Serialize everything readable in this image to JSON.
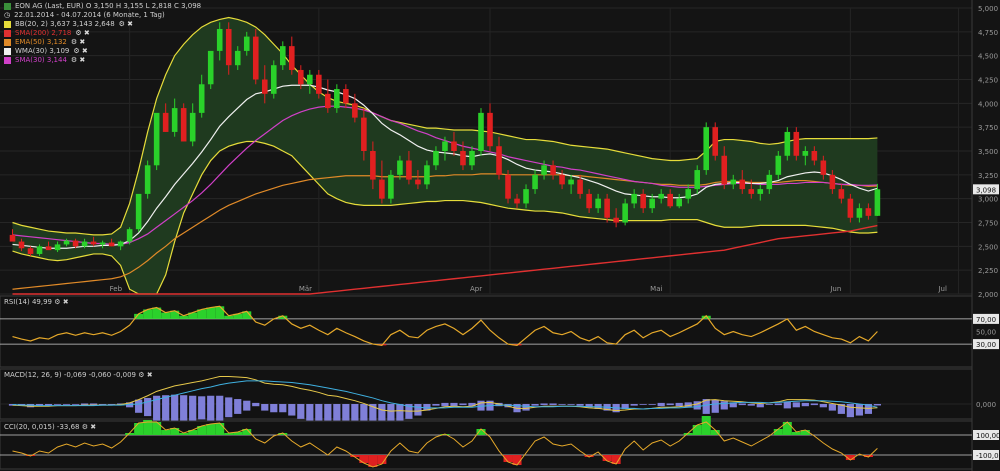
{
  "header": {
    "title": "EON AG (Last, EUR) O 3,150 H 3,155 L 2,818 C 3,098",
    "date_range": "22.01.2014 - 04.07.2014 (6 Monate, 1 Tag)"
  },
  "indicators": [
    {
      "label": "BB(20, 2) 3,637 3,143 2,648",
      "color": "#e6dc3a"
    },
    {
      "label": "SMA(200) 2,718",
      "color": "#e03030"
    },
    {
      "label": "EMA(50) 3,132",
      "color": "#e08a28"
    },
    {
      "label": "WMA(30) 3,109",
      "color": "#f0f0f0"
    },
    {
      "label": "SMA(30) 3,144",
      "color": "#d040c8"
    }
  ],
  "ctl_symbols": "⚙ ✖",
  "price_axis": {
    "ticks": [
      "5,000",
      "4,750",
      "4,500",
      "4,250",
      "4,000",
      "3,750",
      "3,500",
      "3,250",
      "3,000",
      "2,750",
      "2,500",
      "2,250",
      "2,000"
    ],
    "last_price": "3,098"
  },
  "months": [
    "Feb",
    "Mär",
    "Apr",
    "Mai",
    "Jun",
    "Jul"
  ],
  "panels": {
    "rsi": {
      "label": "RSI(14) 49,99",
      "levels": [
        "70,00",
        "50,00",
        "30,00"
      ]
    },
    "macd": {
      "label": "MACD(12, 26, 9) -0,069 -0,060 -0,009",
      "levels": [
        "0,000"
      ]
    },
    "cci": {
      "label": "CCI(20, 0,015) -33,68",
      "levels": [
        "100,00",
        "-100,00"
      ]
    }
  },
  "chart_data": {
    "type": "candlestick",
    "ylim": [
      2.0,
      5.0
    ],
    "candles": [
      [
        2.62,
        2.68,
        2.58,
        2.55
      ],
      [
        2.55,
        2.58,
        2.45,
        2.48
      ],
      [
        2.48,
        2.5,
        2.4,
        2.42
      ],
      [
        2.42,
        2.52,
        2.4,
        2.5
      ],
      [
        2.5,
        2.55,
        2.48,
        2.46
      ],
      [
        2.46,
        2.55,
        2.44,
        2.52
      ],
      [
        2.52,
        2.58,
        2.5,
        2.56
      ],
      [
        2.56,
        2.58,
        2.48,
        2.5
      ],
      [
        2.5,
        2.58,
        2.48,
        2.55
      ],
      [
        2.55,
        2.6,
        2.5,
        2.52
      ],
      [
        2.52,
        2.56,
        2.48,
        2.54
      ],
      [
        2.54,
        2.58,
        2.5,
        2.5
      ],
      [
        2.5,
        2.56,
        2.46,
        2.55
      ],
      [
        2.55,
        2.7,
        2.52,
        2.68
      ],
      [
        2.68,
        3.0,
        2.65,
        3.05
      ],
      [
        3.05,
        3.4,
        3.0,
        3.35
      ],
      [
        3.35,
        3.8,
        3.3,
        3.9
      ],
      [
        3.9,
        4.0,
        3.7,
        3.7
      ],
      [
        3.7,
        4.05,
        3.65,
        3.95
      ],
      [
        3.95,
        4.0,
        3.6,
        3.6
      ],
      [
        3.6,
        4.0,
        3.55,
        3.9
      ],
      [
        3.9,
        4.3,
        3.85,
        4.2
      ],
      [
        4.2,
        4.5,
        4.15,
        4.55
      ],
      [
        4.55,
        4.85,
        4.45,
        4.78
      ],
      [
        4.78,
        4.85,
        4.3,
        4.4
      ],
      [
        4.4,
        4.6,
        4.35,
        4.55
      ],
      [
        4.55,
        4.75,
        4.5,
        4.7
      ],
      [
        4.7,
        4.78,
        4.2,
        4.25
      ],
      [
        4.25,
        4.4,
        4.0,
        4.1
      ],
      [
        4.1,
        4.45,
        4.05,
        4.4
      ],
      [
        4.4,
        4.65,
        4.35,
        4.6
      ],
      [
        4.6,
        4.7,
        4.3,
        4.35
      ],
      [
        4.35,
        4.4,
        4.15,
        4.2
      ],
      [
        4.2,
        4.35,
        4.1,
        4.3
      ],
      [
        4.3,
        4.35,
        4.05,
        4.1
      ],
      [
        4.1,
        4.25,
        3.9,
        3.95
      ],
      [
        3.95,
        4.2,
        3.9,
        4.15
      ],
      [
        4.15,
        4.2,
        3.95,
        4.0
      ],
      [
        4.0,
        4.1,
        3.8,
        3.85
      ],
      [
        3.85,
        3.95,
        3.4,
        3.5
      ],
      [
        3.5,
        3.6,
        3.1,
        3.2
      ],
      [
        3.2,
        3.4,
        2.95,
        3.0
      ],
      [
        3.0,
        3.3,
        2.95,
        3.25
      ],
      [
        3.25,
        3.45,
        3.2,
        3.4
      ],
      [
        3.4,
        3.5,
        3.15,
        3.2
      ],
      [
        3.2,
        3.3,
        3.1,
        3.15
      ],
      [
        3.15,
        3.4,
        3.1,
        3.35
      ],
      [
        3.35,
        3.55,
        3.3,
        3.5
      ],
      [
        3.5,
        3.65,
        3.4,
        3.6
      ],
      [
        3.6,
        3.7,
        3.45,
        3.5
      ],
      [
        3.5,
        3.6,
        3.3,
        3.35
      ],
      [
        3.35,
        3.55,
        3.3,
        3.5
      ],
      [
        3.5,
        3.95,
        3.45,
        3.9
      ],
      [
        3.9,
        4.0,
        3.5,
        3.55
      ],
      [
        3.55,
        3.65,
        3.2,
        3.25
      ],
      [
        3.25,
        3.3,
        2.95,
        3.0
      ],
      [
        3.0,
        3.05,
        2.9,
        2.95
      ],
      [
        2.95,
        3.15,
        2.9,
        3.1
      ],
      [
        3.1,
        3.3,
        3.05,
        3.25
      ],
      [
        3.25,
        3.4,
        3.2,
        3.35
      ],
      [
        3.35,
        3.4,
        3.2,
        3.25
      ],
      [
        3.25,
        3.3,
        3.1,
        3.15
      ],
      [
        3.15,
        3.25,
        3.05,
        3.2
      ],
      [
        3.2,
        3.25,
        3.0,
        3.05
      ],
      [
        3.05,
        3.1,
        2.85,
        2.9
      ],
      [
        2.9,
        3.05,
        2.85,
        3.0
      ],
      [
        3.0,
        3.05,
        2.75,
        2.8
      ],
      [
        2.8,
        2.9,
        2.7,
        2.75
      ],
      [
        2.75,
        3.0,
        2.72,
        2.95
      ],
      [
        2.95,
        3.1,
        2.9,
        3.05
      ],
      [
        3.05,
        3.1,
        2.85,
        2.9
      ],
      [
        2.9,
        3.05,
        2.85,
        3.0
      ],
      [
        3.0,
        3.1,
        2.95,
        3.05
      ],
      [
        3.05,
        3.1,
        2.9,
        2.92
      ],
      [
        2.92,
        3.05,
        2.9,
        3.0
      ],
      [
        3.0,
        3.15,
        2.95,
        3.1
      ],
      [
        3.1,
        3.35,
        3.05,
        3.3
      ],
      [
        3.3,
        3.8,
        3.25,
        3.75
      ],
      [
        3.75,
        3.8,
        3.4,
        3.45
      ],
      [
        3.45,
        3.55,
        3.1,
        3.15
      ],
      [
        3.15,
        3.25,
        3.1,
        3.2
      ],
      [
        3.2,
        3.3,
        3.05,
        3.1
      ],
      [
        3.1,
        3.2,
        3.0,
        3.05
      ],
      [
        3.05,
        3.15,
        2.98,
        3.1
      ],
      [
        3.1,
        3.3,
        3.05,
        3.25
      ],
      [
        3.25,
        3.5,
        3.2,
        3.45
      ],
      [
        3.45,
        3.75,
        3.4,
        3.7
      ],
      [
        3.7,
        3.75,
        3.4,
        3.45
      ],
      [
        3.45,
        3.55,
        3.35,
        3.5
      ],
      [
        3.5,
        3.55,
        3.35,
        3.4
      ],
      [
        3.4,
        3.45,
        3.2,
        3.25
      ],
      [
        3.25,
        3.3,
        3.05,
        3.1
      ],
      [
        3.1,
        3.15,
        2.95,
        3.0
      ],
      [
        3.0,
        3.05,
        2.75,
        2.8
      ],
      [
        2.8,
        2.95,
        2.75,
        2.9
      ],
      [
        2.9,
        2.95,
        2.78,
        2.82
      ],
      [
        2.82,
        3.155,
        2.818,
        3.098
      ]
    ],
    "bb_upper": [
      2.75,
      2.72,
      2.7,
      2.68,
      2.66,
      2.65,
      2.64,
      2.64,
      2.63,
      2.62,
      2.62,
      2.63,
      2.7,
      2.95,
      3.3,
      3.7,
      4.05,
      4.3,
      4.5,
      4.62,
      4.72,
      4.8,
      4.85,
      4.88,
      4.9,
      4.88,
      4.85,
      4.8,
      4.72,
      4.62,
      4.52,
      4.4,
      4.3,
      4.2,
      4.12,
      4.06,
      4.02,
      4.0,
      3.98,
      3.95,
      3.9,
      3.86,
      3.82,
      3.8,
      3.78,
      3.76,
      3.74,
      3.74,
      3.73,
      3.72,
      3.72,
      3.72,
      3.71,
      3.7,
      3.68,
      3.66,
      3.64,
      3.62,
      3.62,
      3.61,
      3.6,
      3.58,
      3.56,
      3.55,
      3.54,
      3.53,
      3.52,
      3.5,
      3.48,
      3.46,
      3.44,
      3.42,
      3.41,
      3.4,
      3.4,
      3.41,
      3.42,
      3.5,
      3.6,
      3.62,
      3.62,
      3.61,
      3.6,
      3.58,
      3.57,
      3.58,
      3.6,
      3.62,
      3.63,
      3.63,
      3.63,
      3.63,
      3.63,
      3.63,
      3.63,
      3.63,
      3.637
    ],
    "bb_lower": [
      2.45,
      2.42,
      2.4,
      2.38,
      2.36,
      2.35,
      2.36,
      2.38,
      2.4,
      2.42,
      2.42,
      2.4,
      2.3,
      2.05,
      1.8,
      1.7,
      1.9,
      2.2,
      2.55,
      2.85,
      3.05,
      3.25,
      3.4,
      3.5,
      3.55,
      3.58,
      3.6,
      3.6,
      3.58,
      3.55,
      3.5,
      3.45,
      3.35,
      3.25,
      3.15,
      3.05,
      3.0,
      2.96,
      2.94,
      2.93,
      2.93,
      2.93,
      2.93,
      2.94,
      2.95,
      2.96,
      2.97,
      2.97,
      2.98,
      2.98,
      2.98,
      2.97,
      2.96,
      2.94,
      2.92,
      2.9,
      2.89,
      2.88,
      2.87,
      2.87,
      2.86,
      2.85,
      2.83,
      2.81,
      2.8,
      2.79,
      2.78,
      2.77,
      2.77,
      2.77,
      2.77,
      2.77,
      2.77,
      2.78,
      2.78,
      2.78,
      2.78,
      2.75,
      2.72,
      2.7,
      2.7,
      2.7,
      2.71,
      2.72,
      2.72,
      2.72,
      2.72,
      2.72,
      2.72,
      2.71,
      2.7,
      2.69,
      2.67,
      2.65,
      2.64,
      2.64,
      2.648
    ],
    "sma200": [
      1.5,
      1.5,
      1.51,
      1.52,
      1.53,
      1.54,
      1.55,
      1.56,
      1.57,
      1.58,
      1.59,
      1.6,
      1.61,
      1.62,
      1.64,
      1.66,
      1.68,
      1.7,
      1.72,
      1.74,
      1.76,
      1.78,
      1.8,
      1.82,
      1.84,
      1.86,
      1.88,
      1.9,
      1.92,
      1.94,
      1.96,
      1.98,
      1.99,
      2.0,
      2.01,
      2.02,
      2.03,
      2.04,
      2.05,
      2.06,
      2.07,
      2.08,
      2.09,
      2.1,
      2.11,
      2.12,
      2.13,
      2.14,
      2.15,
      2.16,
      2.17,
      2.18,
      2.19,
      2.2,
      2.21,
      2.22,
      2.23,
      2.24,
      2.25,
      2.26,
      2.27,
      2.28,
      2.29,
      2.3,
      2.31,
      2.32,
      2.33,
      2.34,
      2.35,
      2.36,
      2.37,
      2.38,
      2.39,
      2.4,
      2.41,
      2.42,
      2.43,
      2.44,
      2.45,
      2.46,
      2.48,
      2.5,
      2.52,
      2.54,
      2.56,
      2.58,
      2.59,
      2.6,
      2.61,
      2.62,
      2.63,
      2.64,
      2.65,
      2.66,
      2.68,
      2.7,
      2.718
    ],
    "ema50": [
      2.05,
      2.06,
      2.07,
      2.08,
      2.09,
      2.1,
      2.11,
      2.12,
      2.13,
      2.14,
      2.15,
      2.16,
      2.18,
      2.22,
      2.28,
      2.35,
      2.43,
      2.5,
      2.58,
      2.64,
      2.7,
      2.76,
      2.82,
      2.88,
      2.93,
      2.97,
      3.01,
      3.05,
      3.08,
      3.11,
      3.14,
      3.16,
      3.18,
      3.2,
      3.21,
      3.22,
      3.23,
      3.24,
      3.24,
      3.24,
      3.24,
      3.23,
      3.23,
      3.23,
      3.23,
      3.23,
      3.23,
      3.24,
      3.24,
      3.25,
      3.25,
      3.25,
      3.26,
      3.26,
      3.26,
      3.25,
      3.25,
      3.25,
      3.25,
      3.25,
      3.25,
      3.25,
      3.24,
      3.24,
      3.23,
      3.22,
      3.21,
      3.2,
      3.19,
      3.18,
      3.17,
      3.16,
      3.15,
      3.15,
      3.14,
      3.14,
      3.14,
      3.15,
      3.17,
      3.18,
      3.18,
      3.18,
      3.17,
      3.17,
      3.17,
      3.17,
      3.18,
      3.19,
      3.19,
      3.18,
      3.17,
      3.16,
      3.15,
      3.14,
      3.14,
      3.13,
      3.132
    ],
    "wma30": [
      2.52,
      2.51,
      2.5,
      2.49,
      2.48,
      2.48,
      2.48,
      2.49,
      2.5,
      2.5,
      2.51,
      2.51,
      2.52,
      2.56,
      2.64,
      2.76,
      2.9,
      3.02,
      3.15,
      3.26,
      3.37,
      3.49,
      3.62,
      3.76,
      3.86,
      3.95,
      4.04,
      4.1,
      4.12,
      4.15,
      4.18,
      4.19,
      4.19,
      4.19,
      4.17,
      4.14,
      4.12,
      4.09,
      4.05,
      3.98,
      3.89,
      3.79,
      3.72,
      3.67,
      3.61,
      3.55,
      3.51,
      3.49,
      3.48,
      3.47,
      3.45,
      3.44,
      3.46,
      3.47,
      3.45,
      3.41,
      3.36,
      3.32,
      3.3,
      3.29,
      3.28,
      3.26,
      3.24,
      3.22,
      3.19,
      3.16,
      3.12,
      3.08,
      3.05,
      3.04,
      3.03,
      3.02,
      3.02,
      3.01,
      3.01,
      3.02,
      3.05,
      3.12,
      3.15,
      3.16,
      3.17,
      3.17,
      3.16,
      3.16,
      3.17,
      3.19,
      3.23,
      3.25,
      3.27,
      3.28,
      3.27,
      3.24,
      3.2,
      3.15,
      3.11,
      3.08,
      3.109
    ],
    "sma30": [
      2.62,
      2.61,
      2.6,
      2.59,
      2.58,
      2.57,
      2.56,
      2.55,
      2.54,
      2.53,
      2.53,
      2.52,
      2.52,
      2.54,
      2.58,
      2.63,
      2.7,
      2.77,
      2.84,
      2.91,
      2.98,
      3.06,
      3.15,
      3.25,
      3.35,
      3.44,
      3.53,
      3.61,
      3.68,
      3.75,
      3.82,
      3.87,
      3.91,
      3.94,
      3.96,
      3.97,
      3.97,
      3.96,
      3.95,
      3.93,
      3.9,
      3.86,
      3.82,
      3.79,
      3.75,
      3.71,
      3.68,
      3.64,
      3.61,
      3.58,
      3.55,
      3.53,
      3.51,
      3.49,
      3.47,
      3.44,
      3.42,
      3.4,
      3.38,
      3.36,
      3.34,
      3.33,
      3.31,
      3.3,
      3.28,
      3.26,
      3.24,
      3.22,
      3.2,
      3.18,
      3.17,
      3.16,
      3.14,
      3.13,
      3.12,
      3.12,
      3.12,
      3.13,
      3.14,
      3.15,
      3.16,
      3.16,
      3.16,
      3.15,
      3.15,
      3.15,
      3.16,
      3.16,
      3.17,
      3.17,
      3.17,
      3.16,
      3.15,
      3.15,
      3.14,
      3.14,
      3.144
    ],
    "rsi": [
      42,
      38,
      35,
      40,
      38,
      45,
      48,
      44,
      48,
      45,
      48,
      44,
      50,
      60,
      78,
      85,
      88,
      80,
      83,
      75,
      80,
      85,
      88,
      90,
      75,
      78,
      82,
      65,
      60,
      70,
      75,
      62,
      55,
      60,
      52,
      45,
      55,
      48,
      42,
      35,
      30,
      28,
      45,
      52,
      42,
      40,
      52,
      58,
      62,
      55,
      45,
      55,
      68,
      52,
      40,
      30,
      28,
      40,
      52,
      58,
      48,
      45,
      50,
      40,
      35,
      42,
      32,
      30,
      45,
      52,
      40,
      48,
      52,
      42,
      48,
      55,
      62,
      75,
      55,
      45,
      50,
      45,
      42,
      48,
      55,
      62,
      70,
      52,
      58,
      50,
      45,
      40,
      38,
      32,
      42,
      35,
      49.99
    ],
    "macd": [
      -0.02,
      -0.03,
      -0.04,
      -0.04,
      -0.04,
      -0.03,
      -0.03,
      -0.03,
      -0.02,
      -0.02,
      -0.02,
      -0.02,
      -0.01,
      0.02,
      0.08,
      0.15,
      0.23,
      0.28,
      0.33,
      0.36,
      0.39,
      0.42,
      0.46,
      0.5,
      0.5,
      0.49,
      0.48,
      0.44,
      0.38,
      0.36,
      0.35,
      0.32,
      0.28,
      0.25,
      0.21,
      0.16,
      0.14,
      0.1,
      0.06,
      0.01,
      -0.05,
      -0.11,
      -0.13,
      -0.12,
      -0.13,
      -0.13,
      -0.11,
      -0.08,
      -0.05,
      -0.04,
      -0.05,
      -0.04,
      0.02,
      0.03,
      0.0,
      -0.04,
      -0.08,
      -0.08,
      -0.06,
      -0.04,
      -0.04,
      -0.04,
      -0.04,
      -0.05,
      -0.07,
      -0.08,
      -0.1,
      -0.12,
      -0.11,
      -0.09,
      -0.09,
      -0.08,
      -0.06,
      -0.06,
      -0.05,
      -0.03,
      0.0,
      0.07,
      0.08,
      0.06,
      0.05,
      0.04,
      0.02,
      0.01,
      0.02,
      0.04,
      0.08,
      0.08,
      0.08,
      0.07,
      0.04,
      0.01,
      -0.02,
      -0.06,
      -0.07,
      -0.08,
      -0.069
    ],
    "macd_signal": [
      -0.01,
      -0.02,
      -0.02,
      -0.03,
      -0.03,
      -0.03,
      -0.03,
      -0.03,
      -0.03,
      -0.03,
      -0.02,
      -0.02,
      -0.02,
      -0.01,
      0.0,
      0.04,
      0.08,
      0.12,
      0.16,
      0.2,
      0.24,
      0.28,
      0.31,
      0.35,
      0.38,
      0.4,
      0.42,
      0.42,
      0.42,
      0.41,
      0.4,
      0.39,
      0.37,
      0.35,
      0.32,
      0.29,
      0.26,
      0.23,
      0.19,
      0.15,
      0.11,
      0.06,
      0.02,
      -0.01,
      -0.04,
      -0.06,
      -0.07,
      -0.07,
      -0.07,
      -0.06,
      -0.06,
      -0.06,
      -0.04,
      -0.03,
      -0.02,
      -0.02,
      -0.03,
      -0.04,
      -0.05,
      -0.05,
      -0.05,
      -0.04,
      -0.04,
      -0.04,
      -0.05,
      -0.05,
      -0.06,
      -0.07,
      -0.08,
      -0.08,
      -0.09,
      -0.08,
      -0.08,
      -0.07,
      -0.07,
      -0.06,
      -0.05,
      -0.02,
      0.0,
      0.01,
      0.02,
      0.03,
      0.03,
      0.03,
      0.02,
      0.03,
      0.04,
      0.05,
      0.06,
      0.06,
      0.06,
      0.05,
      0.04,
      0.02,
      0.0,
      -0.02,
      -0.06
    ],
    "cci": [
      -60,
      -80,
      -110,
      -60,
      -80,
      -20,
      10,
      -20,
      20,
      -10,
      10,
      -30,
      30,
      120,
      220,
      250,
      230,
      150,
      170,
      120,
      150,
      190,
      210,
      220,
      120,
      130,
      160,
      60,
      20,
      90,
      120,
      40,
      -20,
      20,
      -40,
      -100,
      -20,
      -60,
      -120,
      -180,
      -220,
      -190,
      -60,
      20,
      -60,
      -80,
      20,
      80,
      110,
      60,
      -20,
      40,
      160,
      80,
      -60,
      -170,
      -200,
      -80,
      40,
      80,
      10,
      -10,
      10,
      -60,
      -120,
      -70,
      -160,
      -190,
      -40,
      40,
      -50,
      20,
      50,
      -10,
      40,
      120,
      200,
      290,
      150,
      40,
      70,
      30,
      -10,
      40,
      90,
      160,
      230,
      130,
      150,
      90,
      20,
      -40,
      -80,
      -150,
      -90,
      -120,
      -33.68
    ]
  }
}
